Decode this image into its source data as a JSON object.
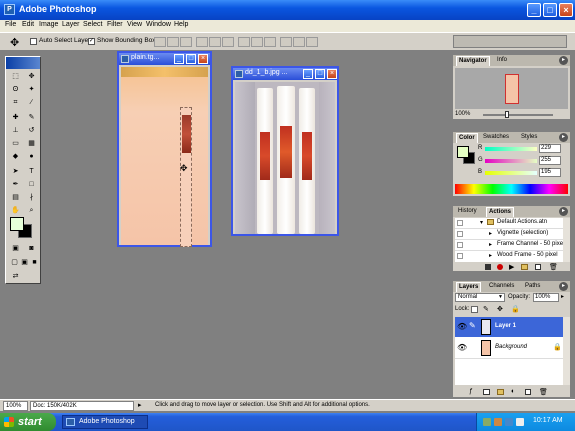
{
  "app": {
    "title": "Adobe Photoshop"
  },
  "window_buttons": {
    "minimize": "_",
    "maximize": "□",
    "close": "×"
  },
  "menu": [
    "File",
    "Edit",
    "Image",
    "Layer",
    "Select",
    "Filter",
    "View",
    "Window",
    "Help"
  ],
  "options": {
    "auto_select_label": "Auto Select Layer",
    "auto_select_checked": false,
    "bounding_box_label": "Show Bounding Box",
    "bounding_box_checked": true
  },
  "documents": [
    {
      "title": "plain.tg...",
      "canvas_color": "#f6c7a8"
    },
    {
      "title": "dd_1_b.jpg ...",
      "canvas_color": "#f3f0ec"
    }
  ],
  "navigator": {
    "tabs": [
      "Navigator",
      "Info"
    ],
    "zoom": "100%"
  },
  "color": {
    "tabs": [
      "Color",
      "Swatches",
      "Styles"
    ],
    "r_label": "R",
    "g_label": "G",
    "b_label": "B",
    "r": "229",
    "g": "255",
    "b": "195"
  },
  "actions": {
    "tabs": [
      "History",
      "Actions"
    ],
    "items": [
      "Default Actions.atn",
      "Vignette (selection)",
      "Frame Channel - 50 pixel",
      "Wood Frame - 50 pixel"
    ]
  },
  "layers": {
    "tabs": [
      "Layers",
      "Channels",
      "Paths"
    ],
    "blend_mode": "Normal",
    "opacity_label": "Opacity:",
    "opacity": "100%",
    "lock_label": "Lock:",
    "items": [
      "Layer 1",
      "Background"
    ]
  },
  "status": {
    "zoom": "100%",
    "doc": "Doc: 150K/402K",
    "hint": "Click and drag to move layer or selection. Use Shift and Alt for additional options."
  },
  "taskbar": {
    "start": "start",
    "task": "Adobe Photoshop",
    "clock": "10:17 AM"
  },
  "colors": {
    "accent": "#2a4ed8",
    "xp_blue": "#245edb",
    "start_green": "#3a9b3a",
    "layer_selected": "#3c66d8",
    "panel_bg": "#d4d0c8",
    "workspace": "#808080"
  }
}
